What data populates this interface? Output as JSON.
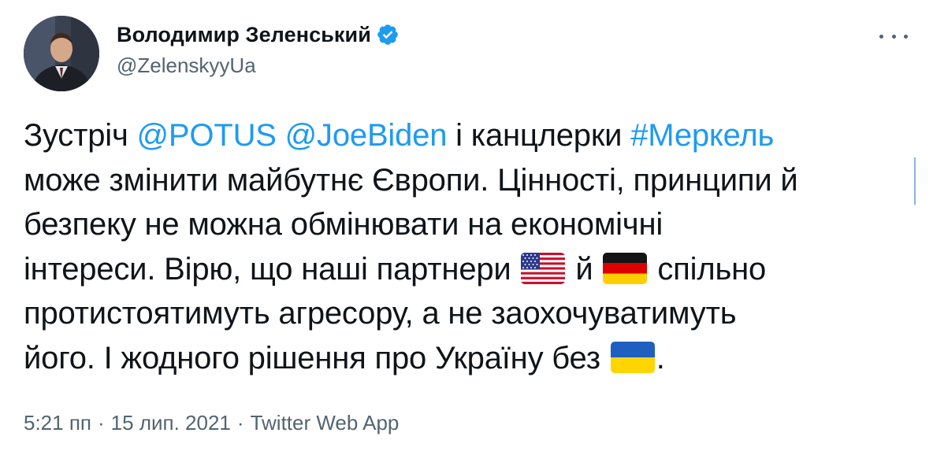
{
  "author": {
    "display_name": "Володимир Зеленський",
    "handle": "@ZelenskyyUa",
    "verified_icon": "verified-badge-icon"
  },
  "more_icon": "more-options-icon",
  "tweet": {
    "line1": {
      "t1": "Зустріч ",
      "mention1": "@POTUS",
      "t2": " ",
      "mention2": "@JoeBiden",
      "t3": " і канцлерки ",
      "hashtag": "#Меркель"
    },
    "line2": "може змінити майбутнє Європи. Цінності, принципи й",
    "line3": "безпеку не можна обмінювати на економічні",
    "line4": {
      "t1": "інтереси. Вірю, що наші партнери ",
      "t2": " й ",
      "t3": " спільно"
    },
    "line5": "протистоятимуть агресору, а не заохочуватимуть",
    "line6": {
      "t1": "його. І жодного рішення про Україну без ",
      "t2": "."
    },
    "flags": [
      "us-flag-icon",
      "germany-flag-icon",
      "ukraine-flag-icon"
    ]
  },
  "meta": {
    "time": "5:21 пп",
    "separator": "·",
    "date": "15 лип. 2021",
    "source": "Twitter Web App"
  },
  "colors": {
    "link": "#1d9bf0",
    "text": "#0f1419",
    "secondary": "#536471"
  }
}
